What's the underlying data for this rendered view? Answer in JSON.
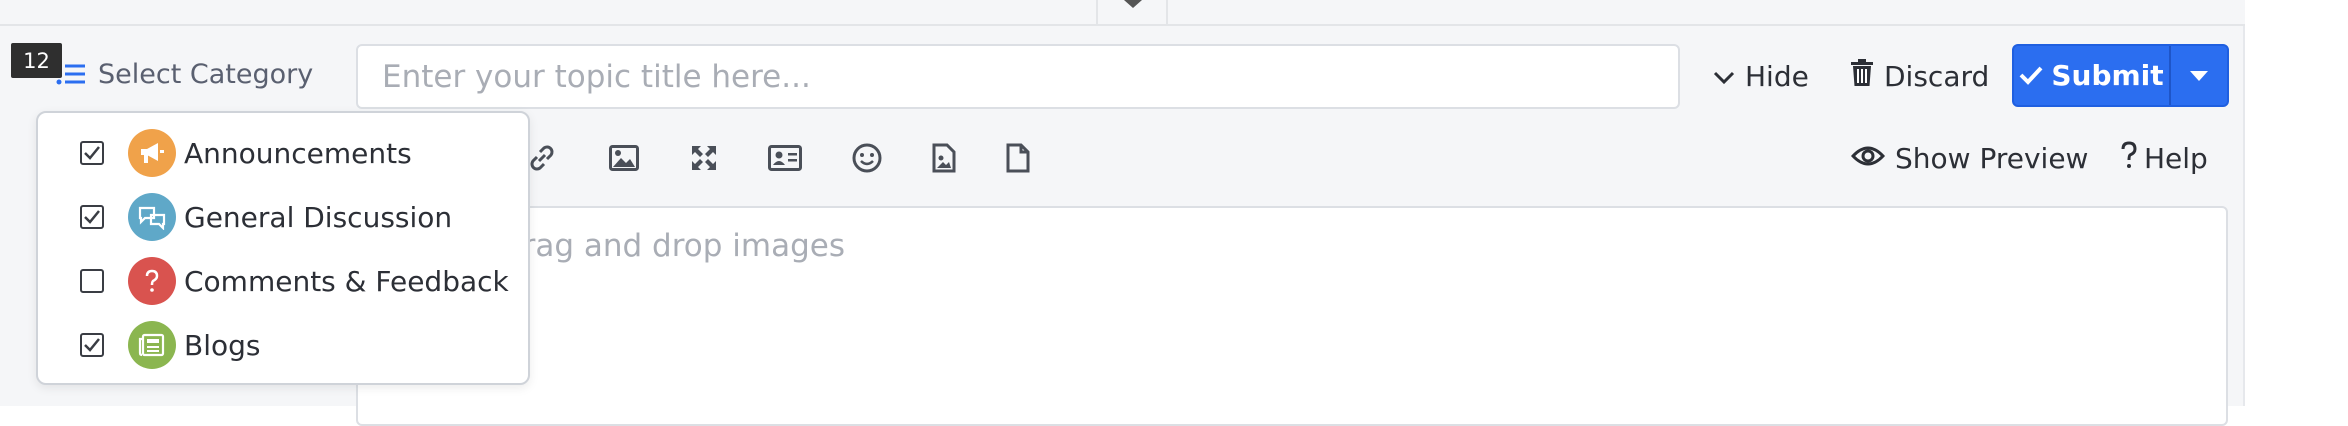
{
  "selection_count": "12",
  "category_selector": {
    "label": "Select Category",
    "icon": "list-icon"
  },
  "title_input": {
    "value": "",
    "placeholder": "Enter your topic title here..."
  },
  "header_actions": {
    "hide_label": "Hide",
    "discard_label": "Discard",
    "submit_label": "Submit"
  },
  "toolbar": {
    "icons": [
      "link-icon",
      "image-icon",
      "expand-icon",
      "id-card-icon",
      "smiley-icon",
      "file-image-icon",
      "file-icon"
    ],
    "show_preview_label": "Show Preview",
    "help_label": "Help"
  },
  "editor": {
    "hint_text": "lrag and drop images"
  },
  "categories": [
    {
      "label": "Announcements",
      "checked": true,
      "icon": "megaphone-icon",
      "color": "#f0a24a"
    },
    {
      "label": "General Discussion",
      "checked": true,
      "icon": "chat-bubbles-icon",
      "color": "#5fa8c8"
    },
    {
      "label": "Comments & Feedback",
      "checked": false,
      "icon": "question-icon",
      "color": "#d9534f"
    },
    {
      "label": "Blogs",
      "checked": true,
      "icon": "newspaper-icon",
      "color": "#8bb650"
    }
  ],
  "colors": {
    "primary": "#2b6ef0",
    "background": "#f5f6f8"
  }
}
